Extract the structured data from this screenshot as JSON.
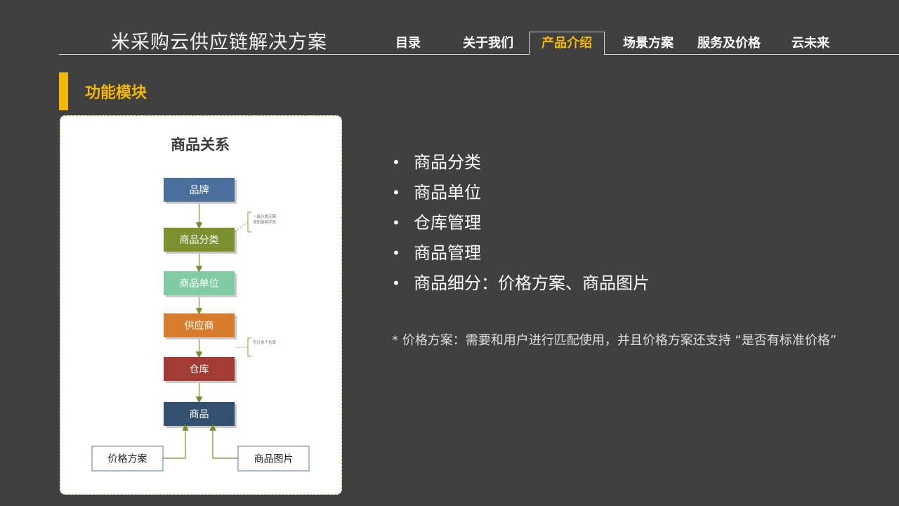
{
  "header": {
    "title": "米采购云供应链解决方案",
    "tabs": [
      {
        "label": "目录"
      },
      {
        "label": "关于我们"
      },
      {
        "label": "产品介绍",
        "active": true
      },
      {
        "label": "场景方案"
      },
      {
        "label": "服务及价格"
      },
      {
        "label": "云未来"
      }
    ]
  },
  "section": {
    "title": "功能模块"
  },
  "diagram": {
    "title": "商品关系",
    "chain": [
      {
        "label": "品牌",
        "color": "#4a6f9c"
      },
      {
        "label": "商品分类",
        "color": "#7b9130"
      },
      {
        "label": "商品单位",
        "color": "#7ecba4"
      },
      {
        "label": "供应商",
        "color": "#d77b2c"
      },
      {
        "label": "仓库",
        "color": "#a33c34"
      },
      {
        "label": "商品",
        "color": "#34506f"
      }
    ],
    "inputs": [
      {
        "label": "价格方案"
      },
      {
        "label": "商品图片"
      }
    ],
    "notes": [
      {
        "lines": [
          "一级分类无需",
          "添加该档字段"
        ]
      },
      {
        "lines": [
          "可分多个仓库"
        ]
      }
    ],
    "line_color": "#7b8a2c"
  },
  "bullets": [
    {
      "text": "商品分类"
    },
    {
      "text": "商品单位"
    },
    {
      "text": "仓库管理"
    },
    {
      "text": "商品管理"
    },
    {
      "text": "商品细分：价格方案、商品图片"
    }
  ],
  "footnote": "* 价格方案：需要和用户进行匹配使用，并且价格方案还支持 “是否有标准价格”",
  "colors": {
    "accent": "#f5b800",
    "background": "#404040"
  }
}
